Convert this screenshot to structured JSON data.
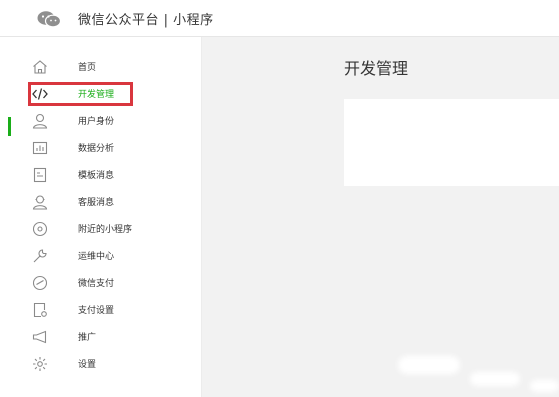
{
  "header": {
    "title": "微信公众平台 | 小程序",
    "logo_icon": "wechat-logo-icon"
  },
  "sidebar": {
    "active_index": 1,
    "accent_color": "#1aad19",
    "highlight_color": "#d9363e",
    "items": [
      {
        "label": "首页",
        "icon": "home-icon"
      },
      {
        "label": "开发管理",
        "icon": "code-icon"
      },
      {
        "label": "用户身份",
        "icon": "user-icon"
      },
      {
        "label": "数据分析",
        "icon": "bar-chart-icon"
      },
      {
        "label": "模板消息",
        "icon": "template-icon"
      },
      {
        "label": "客服消息",
        "icon": "customer-service-icon"
      },
      {
        "label": "附近的小程序",
        "icon": "location-icon"
      },
      {
        "label": "运维中心",
        "icon": "wrench-icon"
      },
      {
        "label": "微信支付",
        "icon": "payment-icon"
      },
      {
        "label": "支付设置",
        "icon": "payment-settings-icon"
      },
      {
        "label": "推广",
        "icon": "megaphone-icon"
      },
      {
        "label": "设置",
        "icon": "gear-icon"
      }
    ]
  },
  "main": {
    "page_title": "开发管理"
  }
}
